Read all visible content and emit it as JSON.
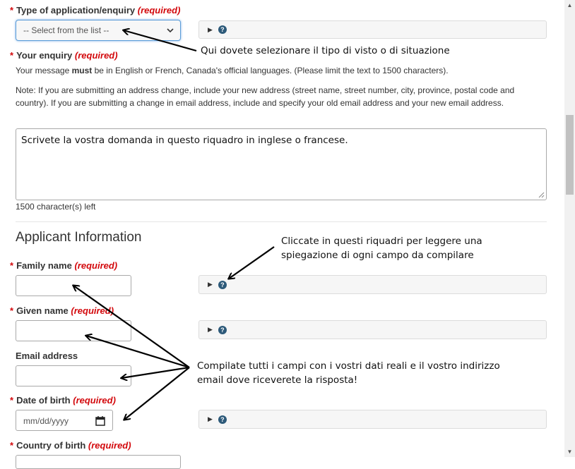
{
  "required_text": "(required)",
  "required_mark": "*",
  "fields": {
    "type_label": "Type of application/enquiry",
    "type_select_value": "-- Select from the list --",
    "enquiry_label": "Your enquiry",
    "enquiry_msg_1": "Your message ",
    "enquiry_msg_bold": "must",
    "enquiry_msg_2": " be in English or French, Canada's official languages. (Please limit the text to 1500 characters).",
    "enquiry_note": "Note: If you are submitting an address change, include your new address (street name, street number, city, province, postal code and country). If you are submitting a change in email address, include and specify your old email address and your new email address.",
    "enquiry_value": "Scrivete la vostra domanda in questo riquadro in inglese o francese.",
    "chars_left": "1500 character(s) left",
    "section_title": "Applicant Information",
    "family_label": "Family name",
    "given_label": "Given name",
    "email_label": "Email address",
    "dob_label": "Date of birth",
    "dob_placeholder": "mm/dd/yyyy",
    "country_label": "Country of birth"
  },
  "annotations": {
    "select_note": "Qui dovete selezionare il tipo di visto o di situazione",
    "help_note_1": "Cliccate in questi riquadri per leggere una",
    "help_note_2": "spiegazione di ogni campo da compilare",
    "fill_note_1": "Compilate tutti i campi con i vostri dati reali e il vostro indirizzo",
    "fill_note_2": "email dove riceverete la risposta!"
  },
  "icons": {
    "help": "question-mark-circle",
    "expand": "triangle-right",
    "calendar": "calendar",
    "select_chevron": "chevron-down"
  },
  "colors": {
    "required": "#d3080c",
    "focus_border": "#5b9dd9",
    "help_icon": "#2d5a7a"
  }
}
